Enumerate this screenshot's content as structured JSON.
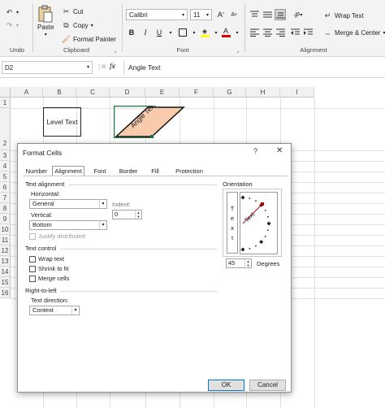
{
  "ribbon": {
    "undo_label": "Undo",
    "clipboard": {
      "label": "Clipboard",
      "paste": "Paste",
      "cut": "Cut",
      "copy": "Copy",
      "format_painter": "Format Painter"
    },
    "font": {
      "label": "Font",
      "name": "Calibri",
      "size": "11",
      "bold": "B",
      "italic": "I",
      "underline": "U",
      "grow": "A",
      "shrink": "A",
      "font_color": "A",
      "highlight": "A"
    },
    "alignment": {
      "label": "Alignment",
      "wrap_text": "Wrap Text",
      "merge_center": "Merge & Center"
    }
  },
  "formula_bar": {
    "name_box": "D2",
    "fx": "fx",
    "formula": "Angle Text"
  },
  "sheet": {
    "columns": [
      "A",
      "B",
      "C",
      "D",
      "E",
      "F",
      "G",
      "H",
      "I"
    ],
    "rows": [
      "1",
      "2",
      "3",
      "4",
      "5",
      "6",
      "7",
      "8",
      "9",
      "10",
      "11",
      "12",
      "13",
      "14",
      "15",
      "16"
    ],
    "b2": "Level Text",
    "d2": "Angle Text",
    "cell_fill": "#f8cbad"
  },
  "dialog": {
    "title": "Format Cells",
    "help": "?",
    "close": "✕",
    "tabs": [
      "Number",
      "Alignment",
      "Font",
      "Border",
      "Fill",
      "Protection"
    ],
    "active_tab": "Alignment",
    "text_alignment": {
      "section": "Text alignment",
      "horizontal_label": "Horizontal:",
      "horizontal_value": "General",
      "indent_label": "Indent:",
      "indent_value": "0",
      "vertical_label": "Vertical:",
      "vertical_value": "Bottom",
      "justify_distributed": "Justify distributed"
    },
    "text_control": {
      "section": "Text control",
      "wrap_text": "Wrap text",
      "shrink_to_fit": "Shrink to fit",
      "merge_cells": "Merge cells"
    },
    "rtl": {
      "section": "Right-to-left",
      "direction_label": "Text direction:",
      "direction_value": "Context"
    },
    "orientation": {
      "section": "Orientation",
      "vertical_text": [
        "T",
        "e",
        "x",
        "t"
      ],
      "dial_text": "Text",
      "degrees_value": "45",
      "degrees_label": "Degrees"
    },
    "ok": "OK",
    "cancel": "Cancel"
  }
}
